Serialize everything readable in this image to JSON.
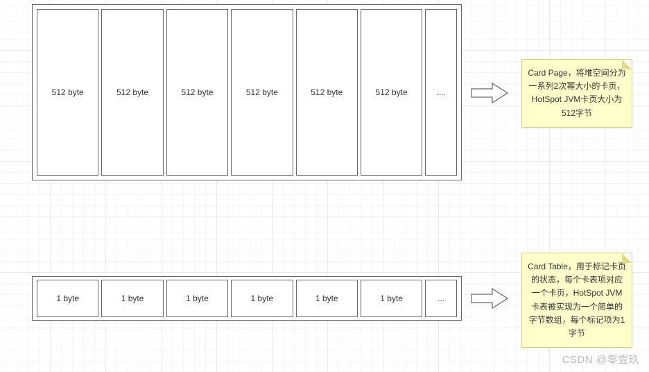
{
  "card_page": {
    "cells": [
      "512 byte",
      "512 byte",
      "512 byte",
      "512 byte",
      "512 byte",
      "512 byte",
      "...."
    ],
    "note": "Card Page，将堆空间分为一系列2次幂大小的卡页，HotSpot JVM卡页大小为512字节"
  },
  "card_table": {
    "cells": [
      "1 byte",
      "1 byte",
      "1 byte",
      "1 byte",
      "1 byte",
      "1 byte",
      "..."
    ],
    "note": "Card Table，用于标记卡页的状态，每个卡表项对应一个卡页，HotSpot JVM卡表被实现为一个简单的字节数组，每个标记项为1字节"
  },
  "watermark": "CSDN @零壹玖"
}
